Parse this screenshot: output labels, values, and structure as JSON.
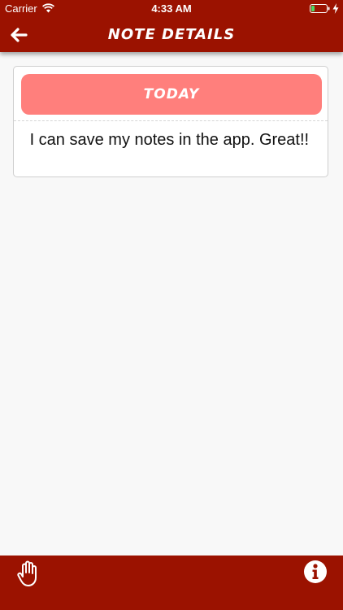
{
  "status_bar": {
    "carrier": "Carrier",
    "time": "4:33 AM"
  },
  "nav": {
    "title": "NOTE DETAILS",
    "back_icon": "arrow-left-icon"
  },
  "note": {
    "date_label": "TODAY",
    "text": " I can save my notes in the app. Great!!"
  },
  "toolbar": {
    "left_icon": "hand-icon",
    "right_icon": "info-icon"
  },
  "colors": {
    "bar": "#9b1200",
    "date_header": "#ff7f7c",
    "background": "#f8f8f8"
  }
}
